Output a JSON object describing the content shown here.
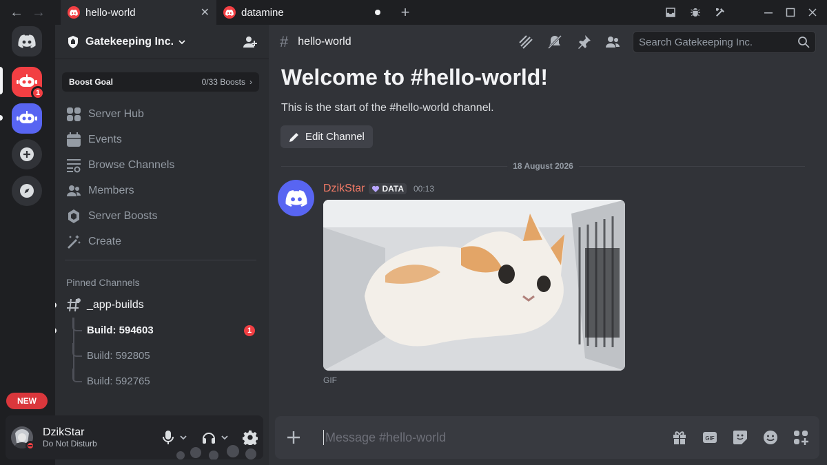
{
  "window": {
    "tabs": [
      {
        "label": "hello-world",
        "active": true
      },
      {
        "label": "datamine",
        "active": false
      }
    ]
  },
  "rail": {
    "notification_count": "1",
    "new_label": "NEW"
  },
  "server": {
    "name": "Gatekeeping Inc.",
    "boost_goal_label": "Boost Goal",
    "boost_count": "0/33 Boosts",
    "nav": [
      {
        "label": "Server Hub",
        "icon": "grid-icon"
      },
      {
        "label": "Events",
        "icon": "calendar-icon"
      },
      {
        "label": "Browse Channels",
        "icon": "browse-channels-icon"
      },
      {
        "label": "Members",
        "icon": "members-icon"
      },
      {
        "label": "Server Boosts",
        "icon": "boost-icon"
      },
      {
        "label": "Create",
        "icon": "wand-icon"
      }
    ],
    "pinned_label": "Pinned Channels",
    "pinned_channel": "_app-builds",
    "threads": [
      {
        "label": "Build: 594603",
        "unread": true,
        "badge": "1"
      },
      {
        "label": "Build: 592805",
        "unread": false
      },
      {
        "label": "Build: 592765",
        "unread": false
      }
    ]
  },
  "user": {
    "name": "DzikStar",
    "status": "Do Not Disturb"
  },
  "channel": {
    "name": "hello-world",
    "search_placeholder": "Search Gatekeeping Inc.",
    "welcome_title": "Welcome to #hello-world!",
    "welcome_sub": "This is the start of the #hello-world channel.",
    "edit_label": "Edit Channel",
    "date": "18 August 2026"
  },
  "message": {
    "author": "DzikStar",
    "tag": "DATA",
    "time": "00:13",
    "attachment_label": "GIF"
  },
  "composer": {
    "placeholder": "Message #hello-world"
  },
  "colors": {
    "accent": "#5865f2",
    "danger": "#f23f43",
    "author": "#f47b67"
  }
}
